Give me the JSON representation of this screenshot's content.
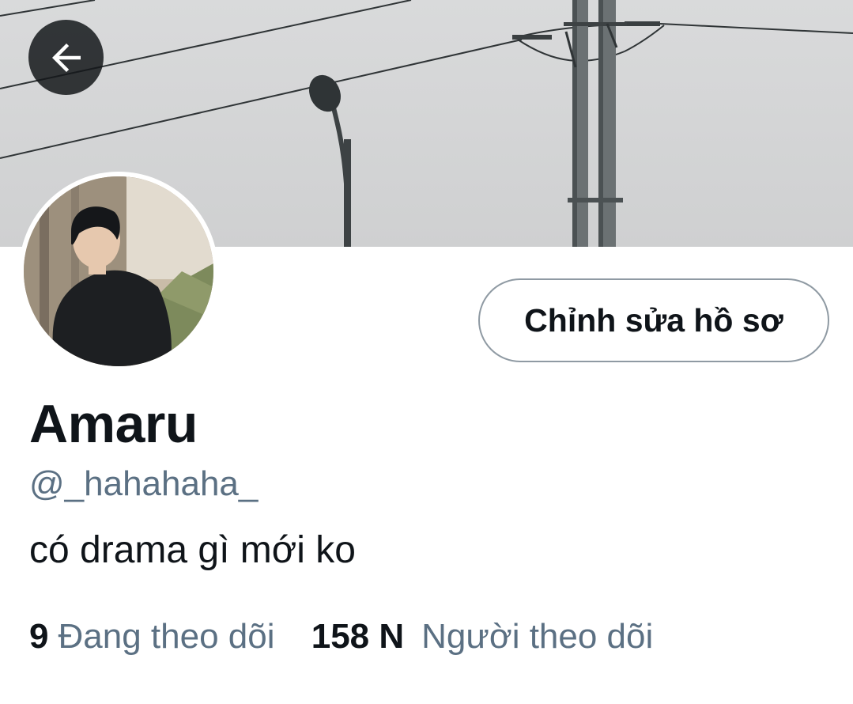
{
  "header": {
    "back_icon": "arrow-left-icon",
    "banner_image": "overcast sky with street lamp and utility poles with power lines"
  },
  "profile": {
    "avatar_image": "young man in black t-shirt",
    "edit_button_label": "Chỉnh sửa hồ sơ",
    "display_name": "Amaru",
    "handle": "@_hahahaha_",
    "bio": "có drama gì mới ko"
  },
  "stats": {
    "following_count": "9",
    "following_label": "Đang theo dõi",
    "followers_count": "158 N",
    "followers_label": "Người theo dõi"
  },
  "colors": {
    "primary_text": "#0f1419",
    "secondary_text": "#5b7083",
    "button_border": "#8f9aa3",
    "back_button_bg": "#14171a"
  }
}
